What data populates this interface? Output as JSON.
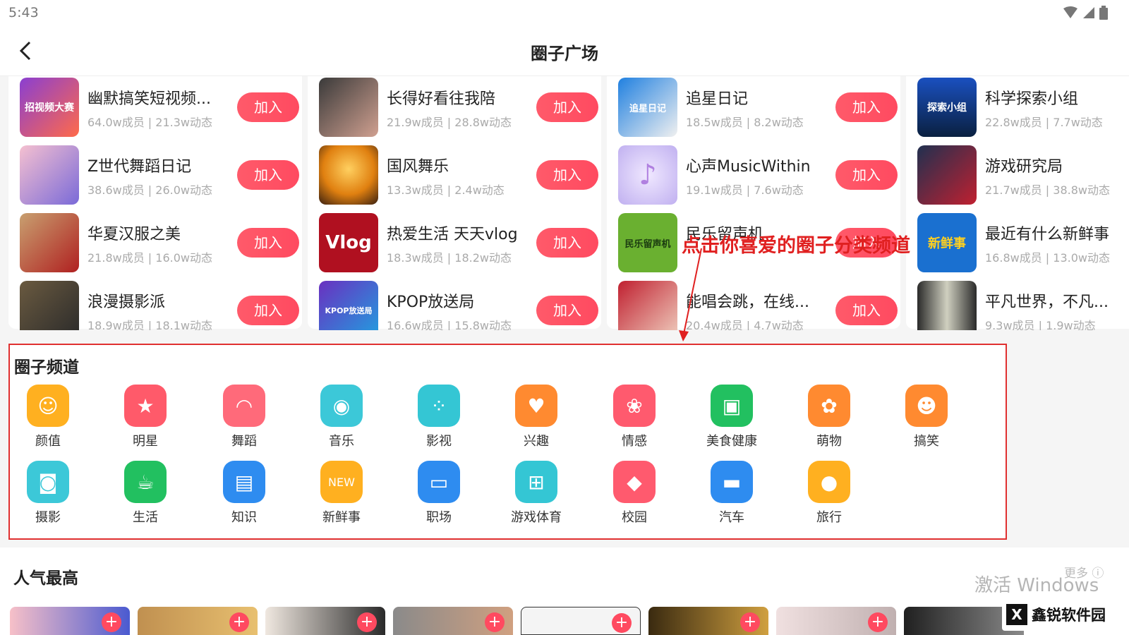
{
  "status": {
    "time": "5:43"
  },
  "header": {
    "title": "圈子广场"
  },
  "cards": [
    {
      "rows": [
        {
          "name": "幽默搞笑短视频...",
          "stats": "64.0w成员 | 21.3w动态",
          "thumb_text": "招视频大赛"
        },
        {
          "name": "Z世代舞蹈日记",
          "stats": "38.6w成员 | 26.0w动态",
          "thumb_text": ""
        },
        {
          "name": "华夏汉服之美",
          "stats": "21.8w成员 | 16.0w动态",
          "thumb_text": ""
        },
        {
          "name": "浪漫摄影派",
          "stats": "18.9w成员 | 18.1w动态",
          "thumb_text": ""
        }
      ]
    },
    {
      "rows": [
        {
          "name": "长得好看往我陪",
          "stats": "21.9w成员 | 28.8w动态",
          "thumb_text": ""
        },
        {
          "name": "国风舞乐",
          "stats": "13.3w成员 | 2.4w动态",
          "thumb_text": ""
        },
        {
          "name": "热爱生活 天天vlog",
          "stats": "18.3w成员 | 18.2w动态",
          "thumb_text": "Vlog"
        },
        {
          "name": "KPOP放送局",
          "stats": "16.6w成员 | 15.8w动态",
          "thumb_text": "KPOP放送局"
        }
      ]
    },
    {
      "rows": [
        {
          "name": "追星日记",
          "stats": "18.5w成员 | 8.2w动态",
          "thumb_text": "追星日记"
        },
        {
          "name": "心声MusicWithin",
          "stats": "19.1w成员 | 7.6w动态",
          "thumb_text": "♪"
        },
        {
          "name": "民乐留声机",
          "stats": "",
          "thumb_text": "民乐留声机"
        },
        {
          "name": "能唱会跳，在线...",
          "stats": "20.4w成员 | 4.7w动态",
          "thumb_text": ""
        }
      ]
    },
    {
      "rows": [
        {
          "name": "科学探索小组",
          "stats": "22.8w成员 | 7.7w动态",
          "thumb_text": "探索小组"
        },
        {
          "name": "游戏研究局",
          "stats": "21.7w成员 | 38.8w动态",
          "thumb_text": ""
        },
        {
          "name": "最近有什么新鲜事",
          "stats": "16.8w成员 | 13.0w动态",
          "thumb_text": "新鲜事"
        },
        {
          "name": "平凡世界，不凡...",
          "stats": "9.3w成员 | 1.9w动态",
          "thumb_text": ""
        }
      ]
    }
  ],
  "join_label": "加入",
  "annotation": "点击你喜爱的圈子分类频道",
  "channels": {
    "title": "圈子频道",
    "items": [
      {
        "label": "颜值",
        "icon": "face-icon",
        "color": "#ffb020",
        "glyph": "☺"
      },
      {
        "label": "明星",
        "icon": "star-icon",
        "color": "#ff5a6a",
        "glyph": "★"
      },
      {
        "label": "舞蹈",
        "icon": "fan-icon",
        "color": "#ff6a7a",
        "glyph": "◠"
      },
      {
        "label": "音乐",
        "icon": "music-disc-icon",
        "color": "#3cc8d8",
        "glyph": "◉"
      },
      {
        "label": "影视",
        "icon": "film-reel-icon",
        "color": "#34c6d4",
        "glyph": "⁘"
      },
      {
        "label": "兴趣",
        "icon": "heart-plus-icon",
        "color": "#ff8a30",
        "glyph": "♥"
      },
      {
        "label": "情感",
        "icon": "flower-icon",
        "color": "#ff5a6e",
        "glyph": "❀"
      },
      {
        "label": "美食健康",
        "icon": "lunchbox-icon",
        "color": "#22c060",
        "glyph": "▣"
      },
      {
        "label": "萌物",
        "icon": "paw-icon",
        "color": "#ff8a30",
        "glyph": "✿"
      },
      {
        "label": "搞笑",
        "icon": "laugh-icon",
        "color": "#ff8a30",
        "glyph": "☻"
      },
      {
        "label": "摄影",
        "icon": "camera-icon",
        "color": "#3cc8d8",
        "glyph": "◙"
      },
      {
        "label": "生活",
        "icon": "cup-icon",
        "color": "#22c060",
        "glyph": "☕"
      },
      {
        "label": "知识",
        "icon": "book-icon",
        "color": "#2e8cf0",
        "glyph": "▤"
      },
      {
        "label": "新鲜事",
        "icon": "new-badge-icon",
        "color": "#ffb020",
        "glyph": "NEW"
      },
      {
        "label": "职场",
        "icon": "briefcase-icon",
        "color": "#2e8cf0",
        "glyph": "▭"
      },
      {
        "label": "游戏体育",
        "icon": "gamepad-icon",
        "color": "#34c6d4",
        "glyph": "⊞"
      },
      {
        "label": "校园",
        "icon": "graduation-cap-icon",
        "color": "#ff5a6e",
        "glyph": "◆"
      },
      {
        "label": "汽车",
        "icon": "car-icon",
        "color": "#2e8cf0",
        "glyph": "▬"
      },
      {
        "label": "旅行",
        "icon": "balloon-icon",
        "color": "#ffb020",
        "glyph": "●"
      }
    ]
  },
  "popular": {
    "title": "人气最高",
    "more_label": "更多 ⓘ"
  },
  "watermark": "激活 Windows",
  "brand": "鑫锐软件园"
}
